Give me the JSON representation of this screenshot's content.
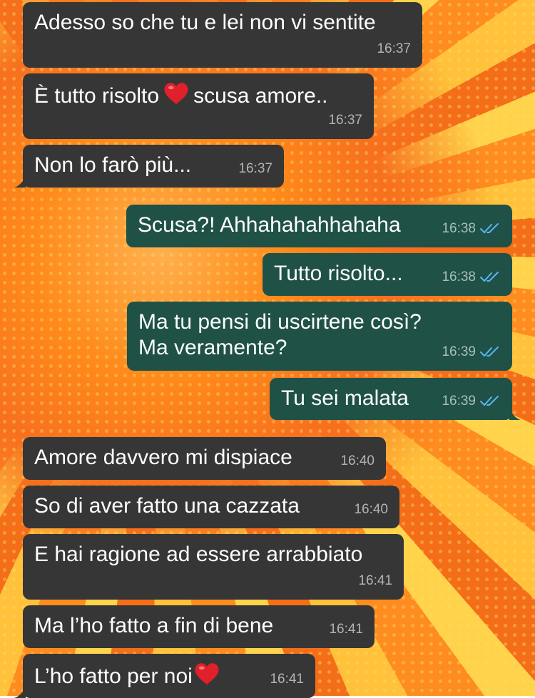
{
  "messages": [
    {
      "direction": "in",
      "text": "Adesso so che tu e lei non vi sentite",
      "time": "16:37"
    },
    {
      "direction": "in",
      "text_before": "È tutto risolto",
      "text_after": "scusa amore..",
      "time": "16:37",
      "emoji": "red-heart-icon"
    },
    {
      "direction": "in",
      "text": "Non lo farò più...",
      "time": "16:37"
    },
    {
      "direction": "out",
      "text": "Scusa?! Ahhahahahhahaha",
      "time": "16:38",
      "status": "read"
    },
    {
      "direction": "out",
      "text": "Tutto risolto...",
      "time": "16:38",
      "status": "read"
    },
    {
      "direction": "out",
      "lines": [
        "Ma tu pensi di uscirtene così?",
        "Ma veramente?"
      ],
      "time": "16:39",
      "status": "read"
    },
    {
      "direction": "out",
      "text": "Tu sei malata",
      "time": "16:39",
      "status": "read"
    },
    {
      "direction": "in",
      "text": "Amore davvero mi dispiace",
      "time": "16:40"
    },
    {
      "direction": "in",
      "text": "So di aver fatto una cazzata",
      "time": "16:40"
    },
    {
      "direction": "in",
      "text": "E hai ragione ad essere arrabbiato",
      "time": "16:41"
    },
    {
      "direction": "in",
      "text": "Ma l’ho fatto a fin di bene",
      "time": "16:41"
    },
    {
      "direction": "in",
      "text_before": "L’ho fatto per noi",
      "time": "16:41",
      "emoji": "red-heart-icon"
    }
  ],
  "colors": {
    "incoming_bubble": "#363636",
    "outgoing_bubble": "#1f5147",
    "read_ticks": "#5ab4f0",
    "wallpaper_primary": "#ff8c1f",
    "wallpaper_secondary": "#ffd44a"
  }
}
